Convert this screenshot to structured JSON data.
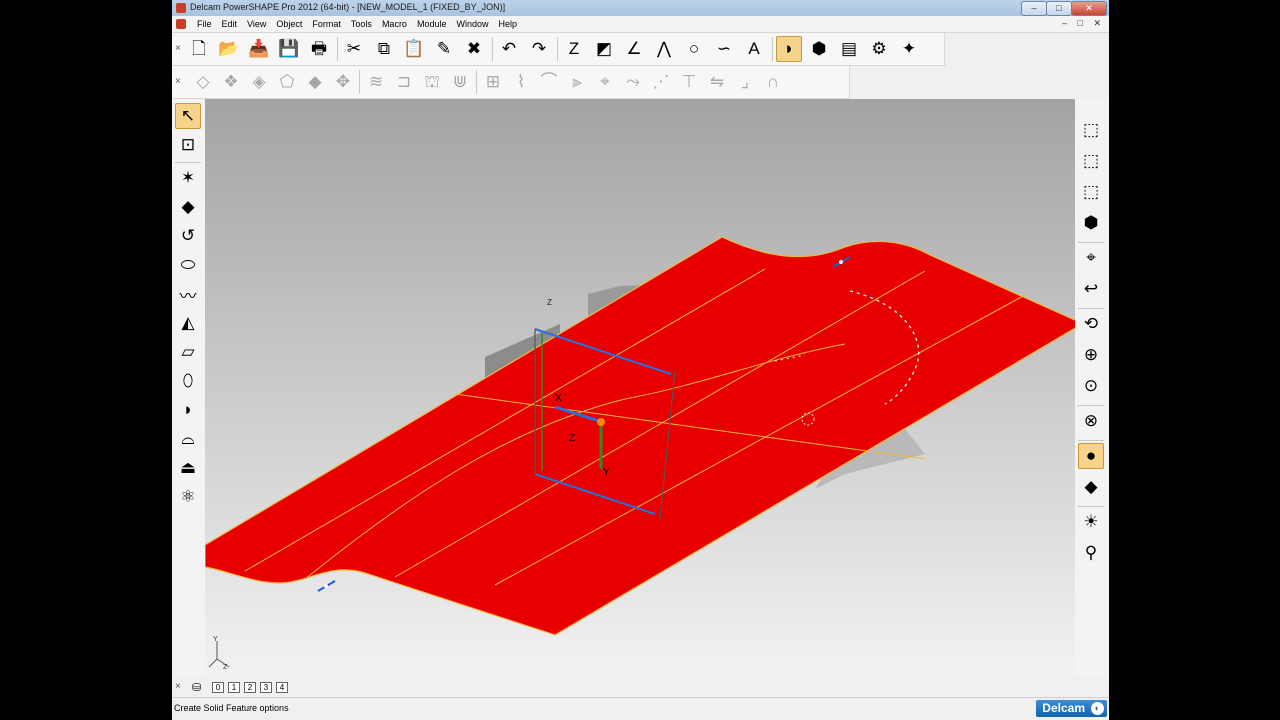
{
  "window": {
    "title": "Delcam PowerSHAPE Pro 2012 (64-bit) - [NEW_MODEL_1 (FIXED_BY_JON)]"
  },
  "menu": [
    "File",
    "Edit",
    "View",
    "Object",
    "Format",
    "Tools",
    "Macro",
    "Module",
    "Window",
    "Help"
  ],
  "main_toolbar": [
    {
      "icon": "new-model-icon",
      "glyph": "🗋"
    },
    {
      "icon": "open-icon",
      "glyph": "📂"
    },
    {
      "icon": "import-icon",
      "glyph": "📥"
    },
    {
      "icon": "save-icon",
      "glyph": "💾"
    },
    {
      "icon": "print-icon",
      "glyph": "🖶"
    },
    {
      "icon": "cut-icon",
      "glyph": "✂"
    },
    {
      "icon": "copy-icon",
      "glyph": "⧉"
    },
    {
      "icon": "paste-icon",
      "glyph": "📋"
    },
    {
      "icon": "edit-icon",
      "glyph": "✎"
    },
    {
      "icon": "delete-icon",
      "glyph": "✖"
    },
    {
      "icon": "undo-icon",
      "glyph": "↶"
    },
    {
      "icon": "redo-icon",
      "glyph": "↷"
    },
    {
      "icon": "workplane-icon",
      "glyph": "Z"
    },
    {
      "icon": "wireframe-icon",
      "glyph": "◩"
    },
    {
      "icon": "line-icon",
      "glyph": "∠"
    },
    {
      "icon": "polyline-icon",
      "glyph": "⋀"
    },
    {
      "icon": "circle-icon",
      "glyph": "○"
    },
    {
      "icon": "curve-icon",
      "glyph": "∽"
    },
    {
      "icon": "text-icon",
      "glyph": "A"
    },
    {
      "icon": "surface-icon",
      "glyph": "◗",
      "active": true
    },
    {
      "icon": "solid-icon",
      "glyph": "⬢"
    },
    {
      "icon": "electrode-icon",
      "glyph": "▤"
    },
    {
      "icon": "assembly-icon",
      "glyph": "⚙"
    },
    {
      "icon": "magic-wand-icon",
      "glyph": "✦"
    }
  ],
  "surface_toolbar": [
    {
      "icon": "primitive-plane-icon",
      "glyph": "◇"
    },
    {
      "icon": "primitive-block-icon",
      "glyph": "❖"
    },
    {
      "icon": "primitive-sphere-icon",
      "glyph": "◈"
    },
    {
      "icon": "primitive-cylinder-icon",
      "glyph": "⬠"
    },
    {
      "icon": "primitive-cone-icon",
      "glyph": "◆"
    },
    {
      "icon": "primitive-torus-icon",
      "glyph": "✥"
    },
    {
      "icon": "smart-surfacer-icon",
      "glyph": "≋"
    },
    {
      "icon": "extrusion-icon",
      "glyph": "⊐"
    },
    {
      "icon": "spine-icon",
      "glyph": "⛫"
    },
    {
      "icon": "drive-curve-icon",
      "glyph": "⋓"
    },
    {
      "icon": "fill-in-icon",
      "glyph": "⊞"
    },
    {
      "icon": "fillet-icon",
      "glyph": "⌇"
    },
    {
      "icon": "blend-icon",
      "glyph": "⌒"
    },
    {
      "icon": "offset-icon",
      "glyph": "⫸"
    },
    {
      "icon": "trim-icon",
      "glyph": "⌖"
    },
    {
      "icon": "extend-icon",
      "glyph": "⤳"
    },
    {
      "icon": "split-icon",
      "glyph": "⋰"
    },
    {
      "icon": "limit-icon",
      "glyph": "⊤"
    },
    {
      "icon": "convert-icon",
      "glyph": "⇋"
    },
    {
      "icon": "corner-icon",
      "glyph": "⌟"
    },
    {
      "icon": "arch-icon",
      "glyph": "∩"
    }
  ],
  "left_toolbar": [
    {
      "icon": "select-arrow-icon",
      "glyph": "↖",
      "active": true
    },
    {
      "icon": "quick-select-icon",
      "glyph": "⊡"
    },
    {
      "icon": "solid-feature-icon",
      "glyph": "✶"
    },
    {
      "icon": "solid-block-icon",
      "glyph": "◆"
    },
    {
      "icon": "solid-rotate-icon",
      "glyph": "↺"
    },
    {
      "icon": "solid-cylinder-icon",
      "glyph": "⬭"
    },
    {
      "icon": "solid-sweep-icon",
      "glyph": "〰"
    },
    {
      "icon": "solid-boolean-icon",
      "glyph": "◭"
    },
    {
      "icon": "solid-extrusion-icon",
      "glyph": "▱"
    },
    {
      "icon": "solid-loft-icon",
      "glyph": "⬯"
    },
    {
      "icon": "solid-fillet-icon",
      "glyph": "◗"
    },
    {
      "icon": "solid-shell-icon",
      "glyph": "⌓"
    },
    {
      "icon": "solid-cut-icon",
      "glyph": "⏏"
    },
    {
      "icon": "solid-pattern-icon",
      "glyph": "⚛"
    }
  ],
  "right_toolbar": [
    {
      "icon": "view-iso-1-icon",
      "glyph": "⬚"
    },
    {
      "icon": "view-iso-2-icon",
      "glyph": "⬚"
    },
    {
      "icon": "view-iso-3-icon",
      "glyph": "⬚"
    },
    {
      "icon": "view-iso-4-icon",
      "glyph": "⬢"
    },
    {
      "icon": "view-camera-icon",
      "glyph": "⌖"
    },
    {
      "icon": "view-previous-icon",
      "glyph": "↩"
    },
    {
      "icon": "rotate-view-icon",
      "glyph": "⟲"
    },
    {
      "icon": "zoom-box-icon",
      "glyph": "⊕"
    },
    {
      "icon": "zoom-fit-icon",
      "glyph": "⊙"
    },
    {
      "icon": "wireframe-view-icon",
      "glyph": "⊗"
    },
    {
      "icon": "shaded-view-icon",
      "glyph": "●",
      "active": true
    },
    {
      "icon": "draft-view-icon",
      "glyph": "◆"
    },
    {
      "icon": "lighting-icon",
      "glyph": "☀"
    },
    {
      "icon": "material-icon",
      "glyph": "⚲"
    }
  ],
  "viewport": {
    "axis_labels": {
      "z": "Z",
      "x": "X",
      "y": "Y"
    },
    "colors": {
      "surface": "#e80000",
      "edge": "#f2b83a",
      "wall": "#8c8c8c",
      "workplane": "#2a6fdb",
      "y_axis": "#2c8c2c",
      "origin": "#ff8a00"
    }
  },
  "levels": [
    "0",
    "1",
    "2",
    "3",
    "4"
  ],
  "status": {
    "message": "Create Solid Feature options",
    "brand": "Delcam"
  }
}
